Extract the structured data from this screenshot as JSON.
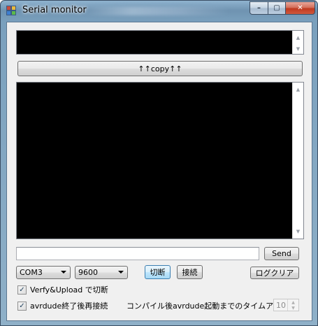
{
  "window": {
    "title": "Serial monitor",
    "minimize_glyph": "–",
    "maximize_glyph": "▢",
    "close_glyph": "✕"
  },
  "copy_button": {
    "label": "↑↑copy↑↑"
  },
  "send": {
    "input_value": "",
    "button_label": "Send"
  },
  "port": {
    "selected": "COM3"
  },
  "baud": {
    "selected": "9600"
  },
  "buttons": {
    "disconnect": "切断",
    "connect": "接続",
    "clear_log": "ログクリア"
  },
  "options": {
    "verify_upload_disconnect": {
      "label": "Verfy&Upload で切断",
      "checked": true
    },
    "reconnect_after_avrdude": {
      "label": "avrdude終了後再接続",
      "checked": true
    }
  },
  "timeout": {
    "label": "コンパイル後avrdude起動までのタイムアウト",
    "value": "10"
  },
  "icons": {
    "check": "✓",
    "scroll_up": "▲",
    "scroll_down": "▼"
  }
}
